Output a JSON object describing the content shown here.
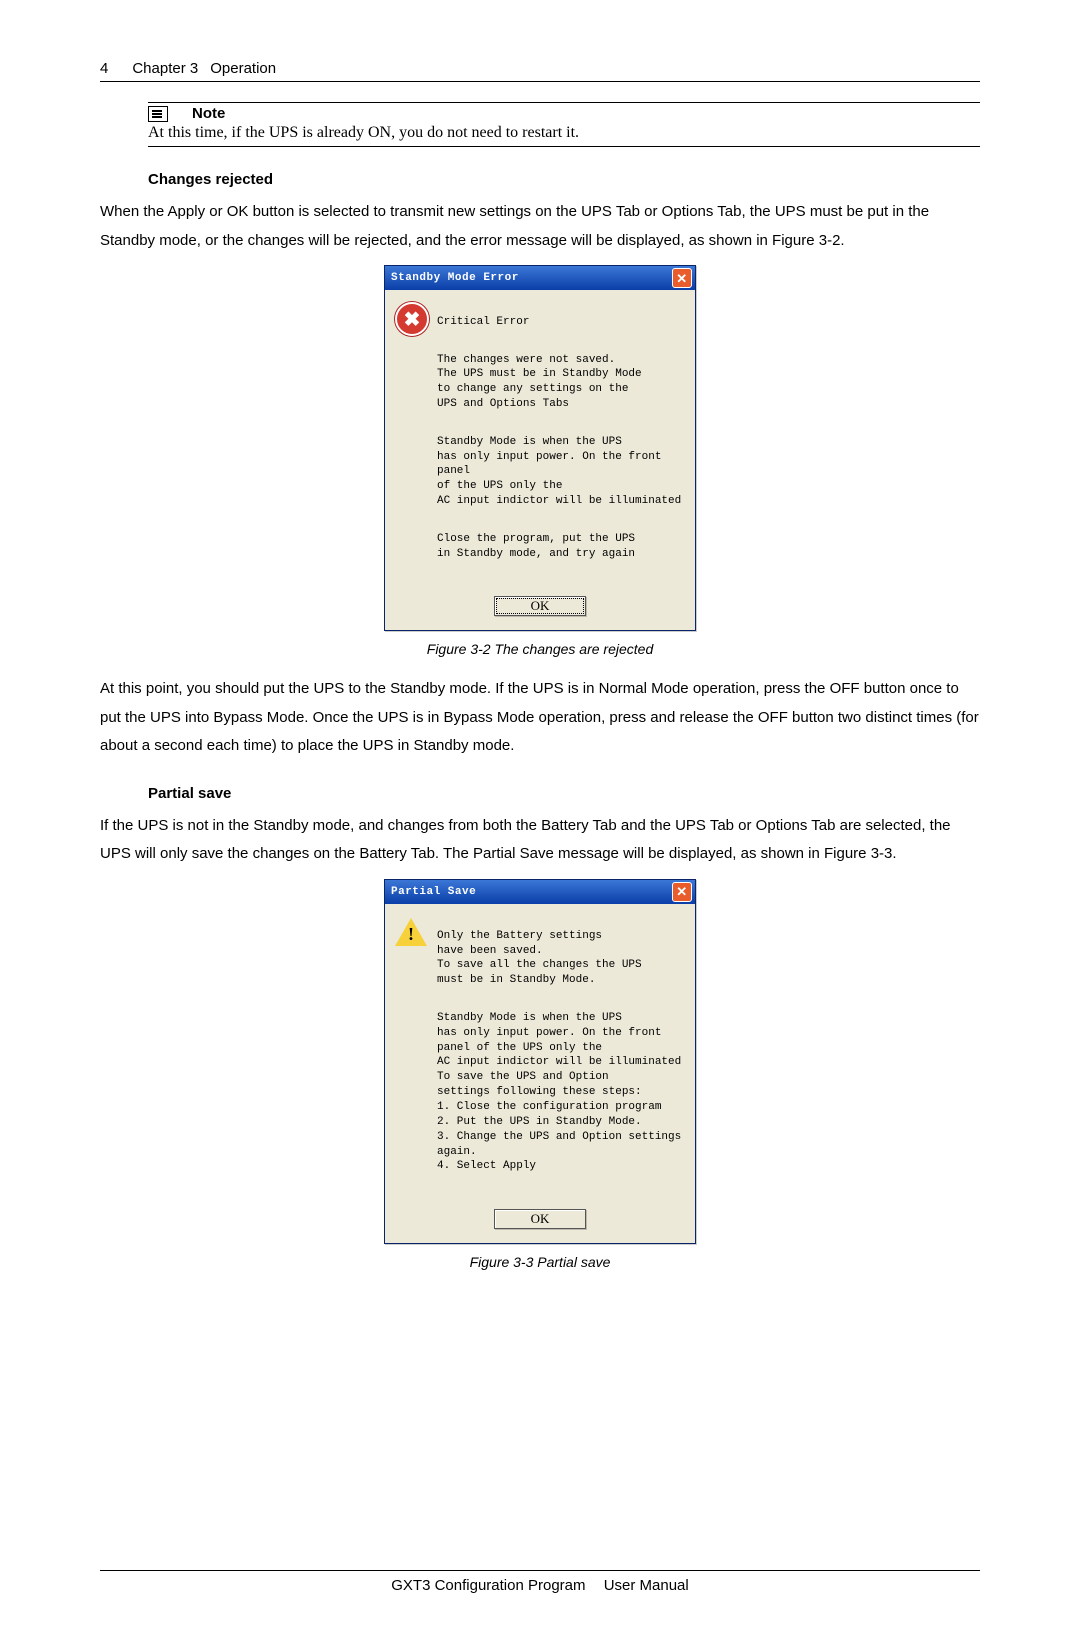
{
  "header": {
    "page_number": "4",
    "chapter": "Chapter 3",
    "chapter_title": "Operation"
  },
  "note": {
    "label": "Note",
    "text": "At this time, if the UPS is already ON, you do not need to restart it."
  },
  "section1": {
    "title": "Changes rejected",
    "para": "When the Apply or OK button is selected to transmit new settings on the UPS Tab or Options Tab, the UPS must be put in the Standby mode, or the changes will be rejected, and the error message will be displayed, as shown in Figure 3-2."
  },
  "dialog1": {
    "title": "Standby Mode Error",
    "close_glyph": "✕",
    "icon_glyph": "✖",
    "p1": "Critical Error",
    "p2": "The changes were not saved.\nThe UPS must be in Standby Mode\nto change any settings on the\nUPS and Options Tabs",
    "p3": "Standby Mode is when the UPS\nhas only input power. On the front panel\nof the UPS only the\nAC input indictor will be illuminated",
    "p4": "Close the program, put the UPS\nin Standby mode, and try again",
    "ok": "OK"
  },
  "figcap1": "Figure 3-2   The changes are rejected",
  "para_after_fig1": "At this point, you should put the UPS to the Standby mode. If the UPS is in Normal Mode operation, press the OFF button once to put the UPS into Bypass Mode. Once the UPS is in Bypass Mode operation, press and release the OFF button two distinct times (for about a second each time) to place the UPS in Standby mode.",
  "section2": {
    "title": "Partial save",
    "para": "If the UPS is not in the Standby mode, and changes from both the Battery Tab and the UPS Tab or Options Tab are selected, the UPS will only save the changes on the Battery Tab. The Partial Save message will be displayed, as shown in Figure 3-3."
  },
  "dialog2": {
    "title": "Partial Save",
    "close_glyph": "✕",
    "p1": "Only the Battery settings\nhave been saved.\nTo save all the changes the UPS\nmust be in Standby Mode.",
    "p2": "Standby Mode is when the UPS\nhas only input power. On the front\npanel of the UPS only the\nAC input indictor will be illuminated\nTo save the UPS and Option\nsettings following these steps:\n1. Close the configuration program\n2. Put the UPS in Standby Mode.\n3. Change the UPS and Option settings\nagain.\n4. Select Apply",
    "ok": "OK"
  },
  "figcap2": "Figure 3-3   Partial save",
  "footer": {
    "left": "GXT3 Configuration Program",
    "right": "User Manual"
  }
}
